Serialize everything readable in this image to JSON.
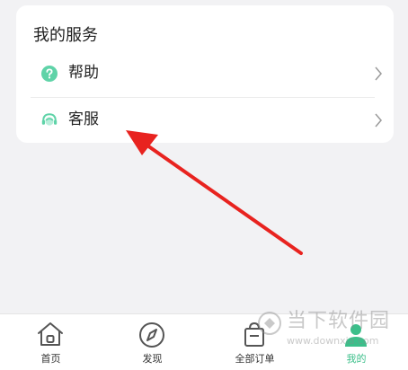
{
  "services": {
    "title": "我的服务",
    "items": [
      {
        "label": "帮助",
        "icon": "help-circle-icon"
      },
      {
        "label": "客服",
        "icon": "customer-service-headset-icon"
      }
    ]
  },
  "tabbar": {
    "tabs": [
      {
        "label": "首页",
        "icon": "home-icon",
        "active": false
      },
      {
        "label": "发现",
        "icon": "compass-icon",
        "active": false
      },
      {
        "label": "全部订单",
        "icon": "order-bag-icon",
        "active": false
      },
      {
        "label": "我的",
        "icon": "user-icon",
        "active": true
      }
    ]
  },
  "watermark": {
    "text": "当下软件园",
    "url": "www.downxia.com"
  },
  "colors": {
    "accent": "#3bbf8a",
    "arrow": "#e8231f",
    "background": "#f2f2f4"
  }
}
